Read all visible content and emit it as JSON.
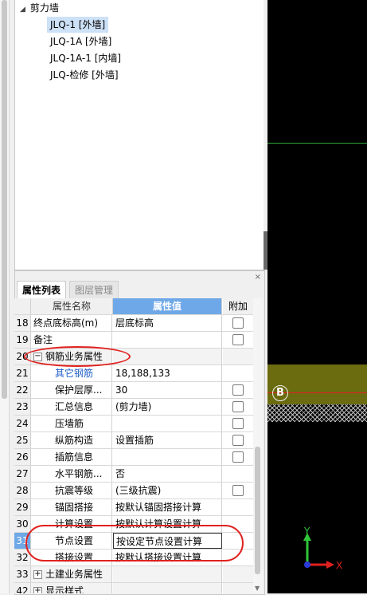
{
  "tree": {
    "group_label": "剪力墙",
    "items": [
      {
        "label": "JLQ-1 [外墙]",
        "selected": true
      },
      {
        "label": "JLQ-1A [外墙]",
        "selected": false
      },
      {
        "label": "JLQ-1A-1 [内墙]",
        "selected": false
      },
      {
        "label": "JLQ-检修 [外墙]",
        "selected": false
      }
    ]
  },
  "panel": {
    "close_glyph": "×",
    "tabs": [
      "属性列表",
      "图层管理"
    ]
  },
  "grid": {
    "headers": {
      "name": "属性名称",
      "value": "属性值",
      "extra": "附加"
    },
    "rows": [
      {
        "num": "18",
        "name": "终点底标高(m)",
        "value": "层底标高"
      },
      {
        "num": "19",
        "name": "备注",
        "value": ""
      },
      {
        "num": "20",
        "name": "钢筋业务属性",
        "value": "",
        "expander": "−"
      },
      {
        "num": "21",
        "name": "其它钢筋",
        "value": "18,188,133"
      },
      {
        "num": "22",
        "name": "保护层厚...",
        "value": "30"
      },
      {
        "num": "23",
        "name": "汇总信息",
        "value": "(剪力墙)"
      },
      {
        "num": "24",
        "name": "压墙筋",
        "value": ""
      },
      {
        "num": "25",
        "name": "纵筋构造",
        "value": "设置插筋"
      },
      {
        "num": "26",
        "name": "插筋信息",
        "value": ""
      },
      {
        "num": "27",
        "name": "水平钢筋...",
        "value": "否"
      },
      {
        "num": "28",
        "name": "抗震等级",
        "value": "(三级抗震)"
      },
      {
        "num": "29",
        "name": "锚固搭接",
        "value": "按默认锚固搭接计算"
      },
      {
        "num": "30",
        "name": "计算设置",
        "value": "按默认计算设置计算"
      },
      {
        "num": "31",
        "name": "节点设置",
        "value": "按设定节点设置计算"
      },
      {
        "num": "32",
        "name": "搭接设置",
        "value": "按默认搭接设置计算"
      },
      {
        "num": "33",
        "name": "土建业务属性",
        "value": "",
        "expander": "+"
      },
      {
        "num": "42",
        "name": "显示样式",
        "value": "",
        "expander": "+"
      }
    ]
  },
  "canvas": {
    "axis_label": "B",
    "colors": {
      "green_line": "#2fa53a",
      "olive_band": "#6b6b10",
      "red_line": "#e02020",
      "annotation": "#e0221f"
    },
    "coord": {
      "x_label": "X",
      "y_label": "Y"
    }
  }
}
